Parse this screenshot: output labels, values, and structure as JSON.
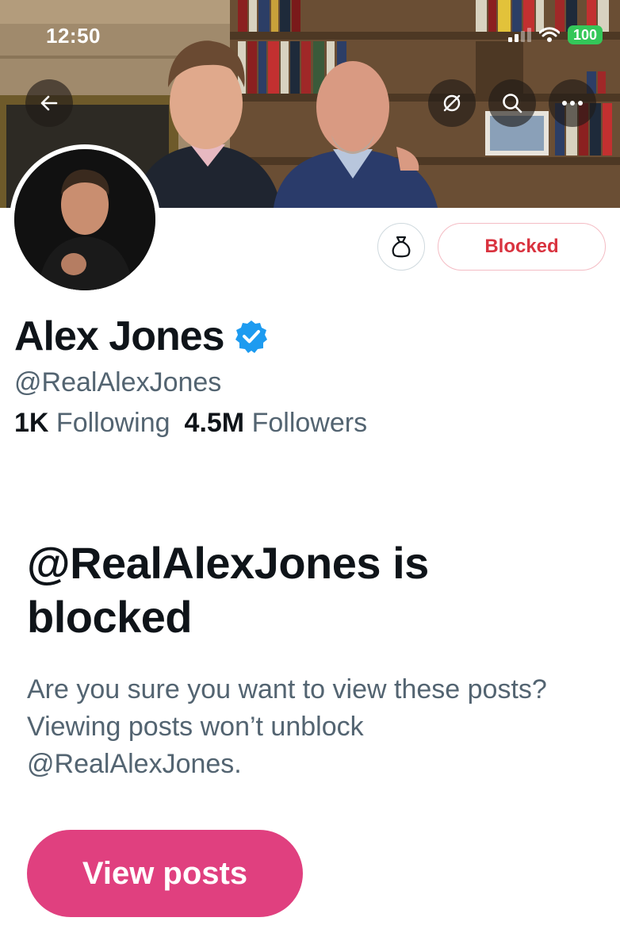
{
  "status_bar": {
    "time": "12:50",
    "battery": "100"
  },
  "nav": {
    "back_icon": "arrow-left-icon",
    "translate_icon": "no-translate-icon",
    "search_icon": "search-icon",
    "more_icon": "more-horizontal-icon"
  },
  "profile": {
    "name": "Alex Jones",
    "verified": true,
    "handle": "@RealAlexJones",
    "following_count": "1K",
    "following_label": "Following",
    "followers_count": "4.5M",
    "followers_label": "Followers",
    "blocked_label": "Blocked",
    "gift_icon": "money-bag-icon"
  },
  "block_notice": {
    "title": "@RealAlexJones is blocked",
    "description": "Are you sure you want to view these posts? Viewing posts won’t unblock @RealAlexJones.",
    "button_label": "View posts"
  },
  "colors": {
    "accent_pink": "#e0407f",
    "blocked_red": "#d9333f",
    "verified_blue": "#1d9bf0",
    "secondary_text": "#536471"
  }
}
